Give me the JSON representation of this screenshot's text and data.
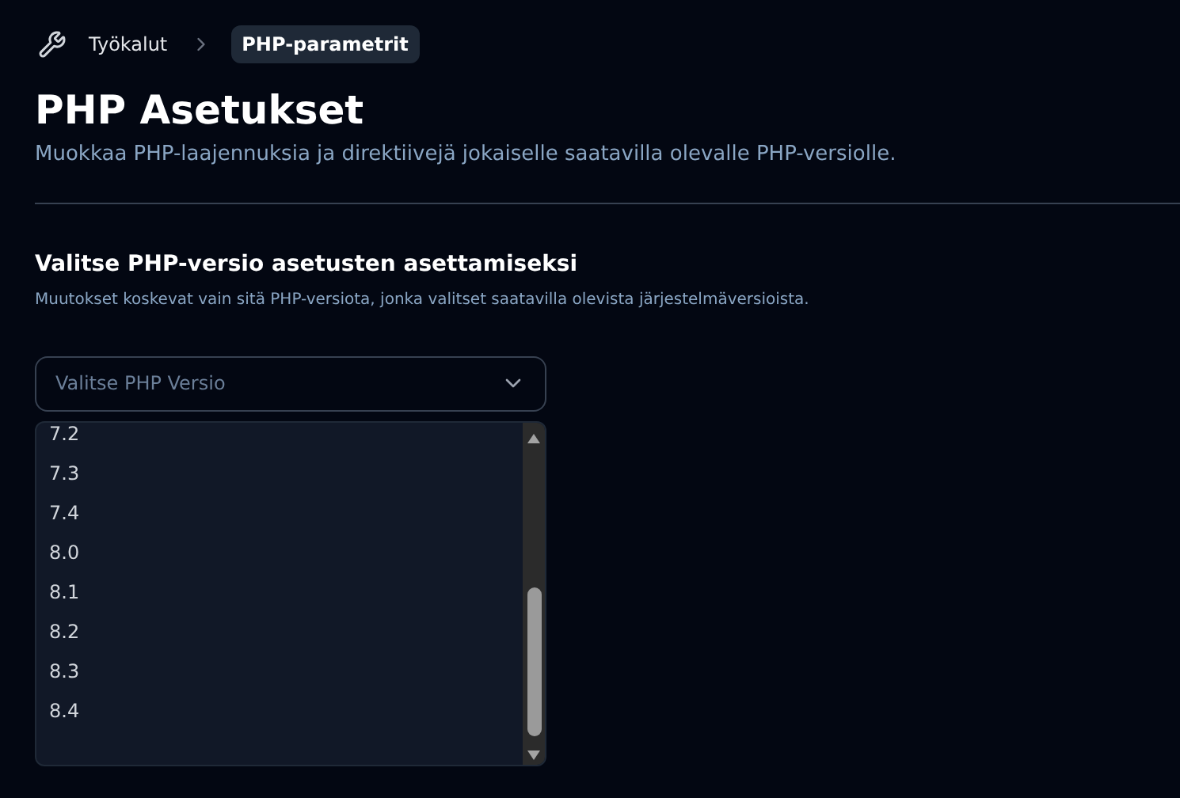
{
  "breadcrumb": [
    {
      "label": "Työkalut",
      "selected": false
    },
    {
      "label": "PHP-parametrit",
      "selected": true
    }
  ],
  "title": "PHP Asetukset",
  "subtitle": "Muokkaa PHP-laajennuksia ja direktiivejä jokaiselle saatavilla olevalle PHP-versiolle.",
  "section": {
    "heading": "Valitse PHP-versio asetusten asettamiseksi",
    "description": "Muutokset koskevat vain sitä PHP-versiota, jonka valitset saatavilla olevista järjestelmäversioista."
  },
  "select": {
    "placeholder": "Valitse PHP Versio",
    "expanded": true,
    "options": [
      "7.2",
      "7.3",
      "7.4",
      "8.0",
      "8.1",
      "8.2",
      "8.3",
      "8.4"
    ]
  }
}
